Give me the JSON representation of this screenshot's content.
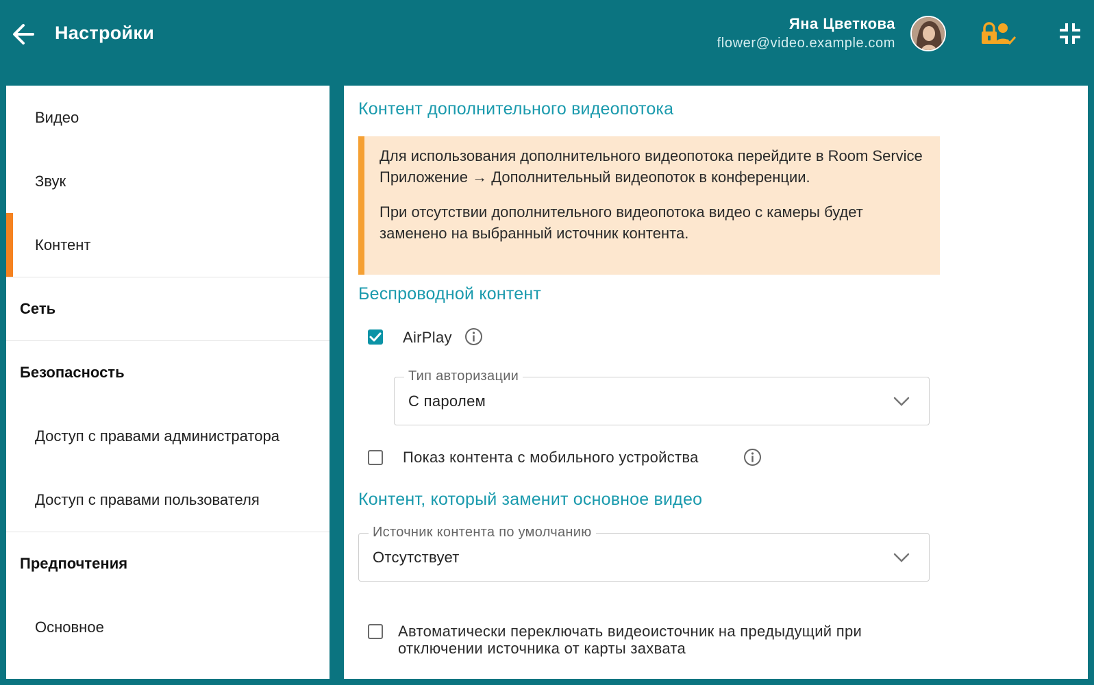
{
  "header": {
    "title": "Настройки",
    "user_name": "Яна Цветкова",
    "user_email": "flower@video.example.com",
    "icons": {
      "back": "arrow-left-icon",
      "avatar": "user-avatar",
      "lock": "lock-user-icon",
      "collapse": "collapse-icon"
    }
  },
  "sidebar": {
    "items": [
      {
        "label": "Видео",
        "type": "sub"
      },
      {
        "label": "Звук",
        "type": "sub"
      },
      {
        "label": "Контент",
        "type": "sub",
        "active": true
      },
      {
        "label": "Сеть",
        "type": "header"
      },
      {
        "label": "Безопасность",
        "type": "header"
      },
      {
        "label": "Доступ с правами администратора",
        "type": "sub"
      },
      {
        "label": "Доступ с правами пользователя",
        "type": "sub"
      },
      {
        "label": "Предпочтения",
        "type": "header"
      },
      {
        "label": "Основное",
        "type": "sub"
      }
    ]
  },
  "main": {
    "section_extra_stream": "Контент дополнительного видеопотока",
    "notice": {
      "paragraph1": "Для использования дополнительного видеопотока перейдите в Room Service Приложение → Дополнительный видеопоток в конференции.",
      "paragraph2": "При отсутствии дополнительного видеопотока видео с камеры будет заменено на выбранный источник контента."
    },
    "section_wireless": "Беспроводной контент",
    "airplay": {
      "label": "AirPlay",
      "checked": true
    },
    "auth_type": {
      "legend": "Тип авторизации",
      "value": "С паролем"
    },
    "mobile_content": {
      "label": "Показ контента с мобильного устройства",
      "checked": false
    },
    "section_replace": "Контент, который заменит основное видео",
    "default_source": {
      "legend": "Источник контента по умолчанию",
      "value": "Отсутствует"
    },
    "auto_switch": {
      "label": "Автоматически переключать видеоисточник на предыдущий при отключении источника от карты захвата",
      "checked": false
    }
  },
  "colors": {
    "header_bg": "#0b7480",
    "accent_orange": "#f58220",
    "section_title": "#1a9aad",
    "checkbox_on": "#0b93a6",
    "notice_bg": "#fde7cf",
    "lock_icon": "#f5a623"
  }
}
